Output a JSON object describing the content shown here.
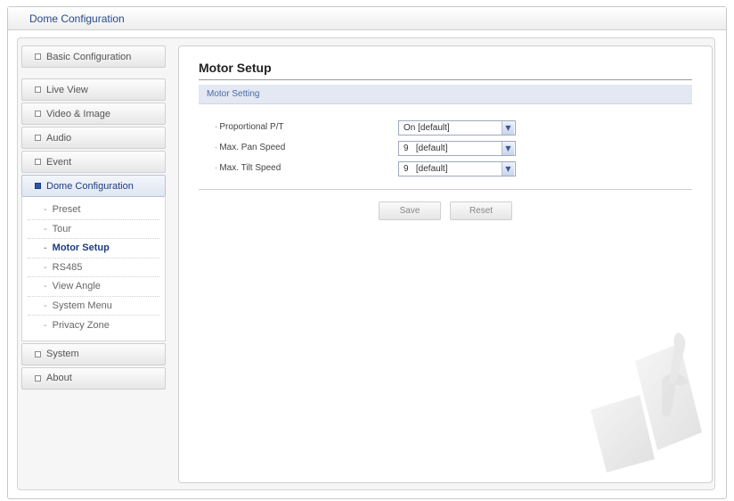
{
  "window": {
    "title": "Dome Configuration"
  },
  "sidebar": {
    "items_top": [
      {
        "label": "Basic Configuration"
      }
    ],
    "items_mid": [
      {
        "label": "Live View"
      },
      {
        "label": "Video & Image"
      },
      {
        "label": "Audio"
      },
      {
        "label": "Event"
      }
    ],
    "active": {
      "label": "Dome Configuration"
    },
    "sub_items": [
      {
        "label": "Preset"
      },
      {
        "label": "Tour"
      },
      {
        "label": "Motor Setup"
      },
      {
        "label": "RS485"
      },
      {
        "label": "View Angle"
      },
      {
        "label": "System Menu"
      },
      {
        "label": "Privacy Zone"
      }
    ],
    "items_bottom": [
      {
        "label": "System"
      },
      {
        "label": "About"
      }
    ]
  },
  "main": {
    "page_title": "Motor Setup",
    "section_title": "Motor Setting",
    "fields": [
      {
        "label": "Proportional P/T",
        "value": "On [default]"
      },
      {
        "label": "Max. Pan Speed",
        "value": "9   [default]"
      },
      {
        "label": "Max. Tilt Speed",
        "value": "9   [default]"
      }
    ],
    "buttons": {
      "save": "Save",
      "reset": "Reset"
    }
  },
  "colors": {
    "accent": "#1d3c80",
    "section_bg": "#e3e8f2"
  },
  "icons": {
    "nav_bullet": "square-box-icon",
    "dropdown": "chevron-down-icon",
    "watermark": "wrench-icon"
  }
}
